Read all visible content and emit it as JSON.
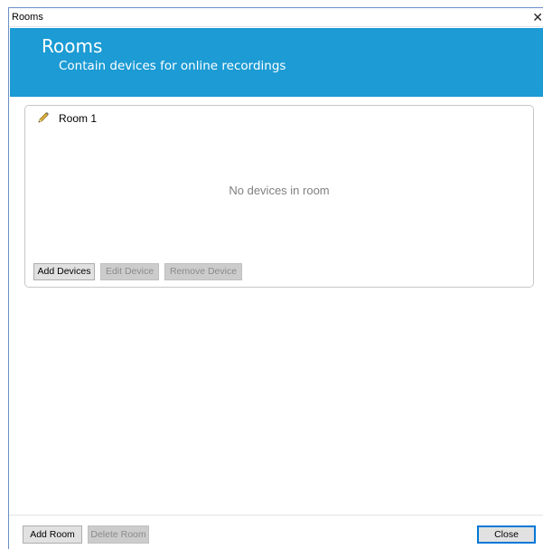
{
  "window": {
    "title": "Rooms",
    "close_glyph": "✕"
  },
  "banner": {
    "title": "Rooms",
    "subtitle": "Contain devices for online recordings",
    "color": "#1c9bd4"
  },
  "room": {
    "name": "Room 1",
    "icon": "pencil-icon",
    "empty_message": "No devices in room",
    "buttons": {
      "add_devices": "Add Devices",
      "edit_device": "Edit Device",
      "remove_device": "Remove Device"
    }
  },
  "footer": {
    "add_room": "Add Room",
    "delete_room": "Delete Room",
    "close": "Close"
  }
}
